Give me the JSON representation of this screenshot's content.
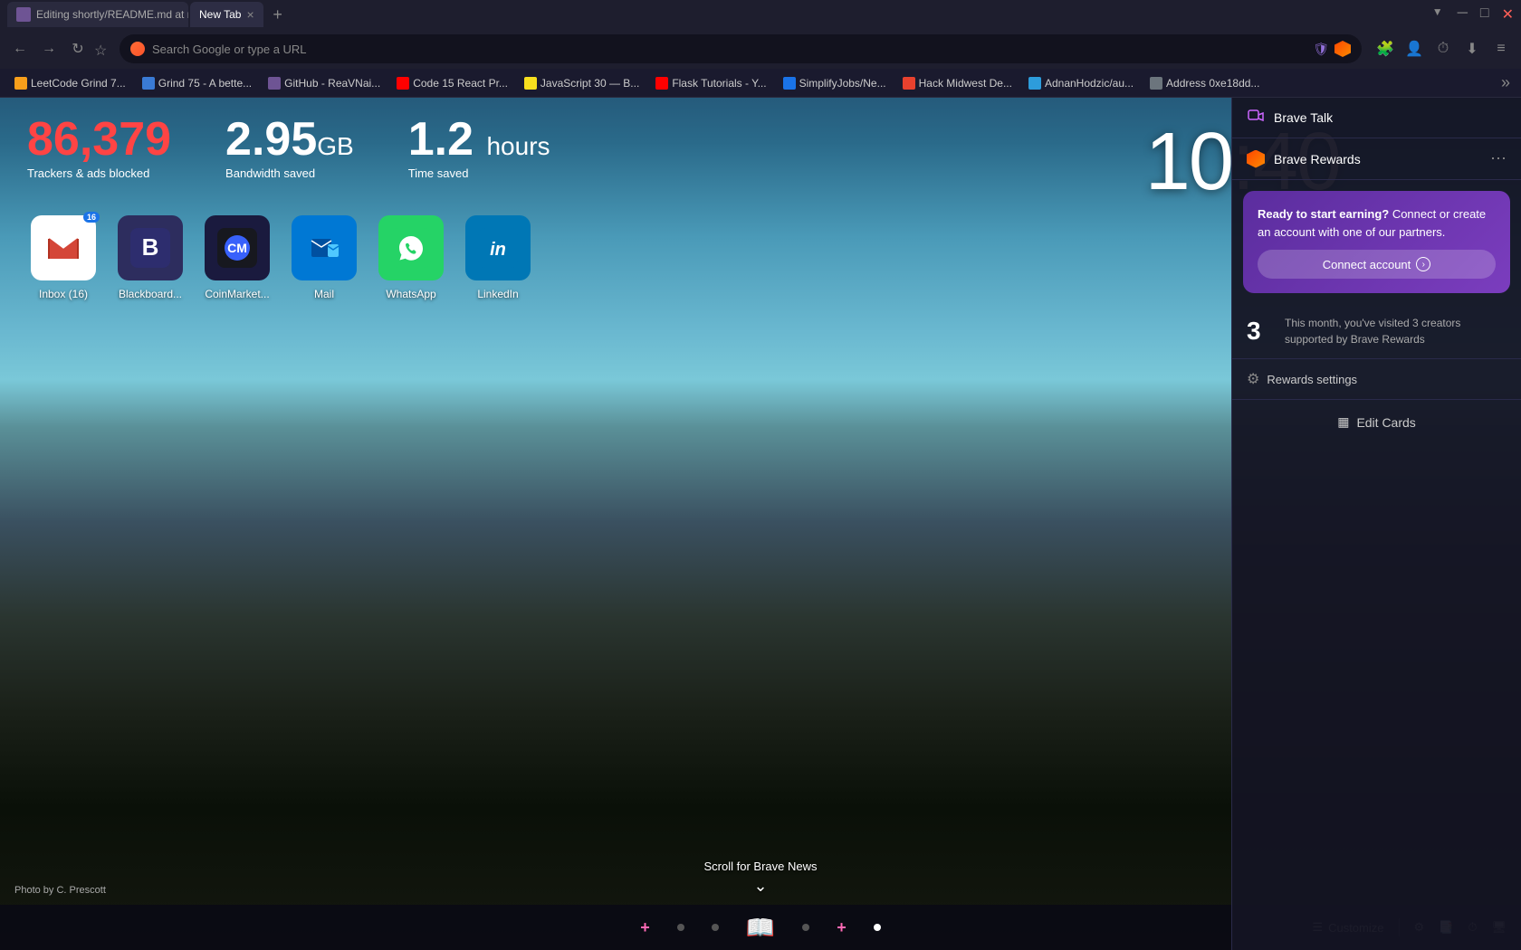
{
  "browser": {
    "tabs": [
      {
        "id": "tab-editing",
        "label": "Editing shortly/README.md at ma...",
        "favicon_class": "fav-gh",
        "active": false
      },
      {
        "id": "tab-newtab",
        "label": "New Tab",
        "favicon_class": "",
        "active": true
      }
    ],
    "address_bar": {
      "placeholder": "Search Google or type a URL",
      "value": "Search Google or type a URL"
    }
  },
  "bookmarks": [
    {
      "id": "bm-lc",
      "label": "LeetCode Grind 7...",
      "favicon_class": "fav-lc"
    },
    {
      "id": "bm-gr",
      "label": "Grind 75 - A bette...",
      "favicon_class": "fav-gr"
    },
    {
      "id": "bm-gh",
      "label": "GitHub - ReaVNai...",
      "favicon_class": "fav-gh"
    },
    {
      "id": "bm-yt1",
      "label": "Code 15 React Pr...",
      "favicon_class": "fav-yt"
    },
    {
      "id": "bm-js",
      "label": "JavaScript 30 — B...",
      "favicon_class": "fav-js"
    },
    {
      "id": "bm-yt2",
      "label": "Flask Tutorials - Y...",
      "favicon_class": "fav-yt"
    },
    {
      "id": "bm-sj",
      "label": "SimplifyJobs/Ne...",
      "favicon_class": "fav-sj"
    },
    {
      "id": "bm-hm",
      "label": "Hack Midwest De...",
      "favicon_class": "fav-hm"
    },
    {
      "id": "bm-ad",
      "label": "AdnanHodzic/au...",
      "favicon_class": "fav-ad"
    },
    {
      "id": "bm-et",
      "label": "Address 0xe18dd...",
      "favicon_class": "fav-et"
    }
  ],
  "stats": {
    "trackers_count": "86,379",
    "trackers_label": "Trackers & ads blocked",
    "bandwidth_number": "2.95",
    "bandwidth_unit": "GB",
    "bandwidth_label": "Bandwidth saved",
    "time_number": "1.2",
    "time_unit": "hours",
    "time_label": "Time saved"
  },
  "clock": {
    "time": "10:40"
  },
  "shortcuts": [
    {
      "id": "sc-gmail",
      "label": "Inbox (16)",
      "icon_class": "icon-gmail",
      "icon_text": "✉",
      "badge": "16"
    },
    {
      "id": "sc-blackboard",
      "label": "Blackboard...",
      "icon_class": "icon-blackboard",
      "icon_text": "B",
      "badge": null
    },
    {
      "id": "sc-coinmarket",
      "label": "CoinMarket...",
      "icon_class": "icon-coinmarket",
      "icon_text": "CM",
      "badge": null
    },
    {
      "id": "sc-mail",
      "label": "Mail",
      "icon_class": "icon-mail",
      "icon_text": "✉",
      "badge": null
    },
    {
      "id": "sc-whatsapp",
      "label": "WhatsApp",
      "icon_class": "icon-whatsapp",
      "icon_text": "💬",
      "badge": null
    },
    {
      "id": "sc-linkedin",
      "label": "LinkedIn",
      "icon_class": "icon-linkedin",
      "icon_text": "in",
      "badge": null
    }
  ],
  "right_panel": {
    "brave_talk_label": "Brave Talk",
    "brave_rewards_label": "Brave Rewards",
    "rewards_card": {
      "title_bold": "Ready to start earning?",
      "title_rest": " Connect or create an account with one of our partners.",
      "connect_btn_label": "Connect account"
    },
    "creators_count": "3",
    "creators_description": "This month, you've visited 3 creators supported by Brave Rewards",
    "rewards_settings_label": "Rewards settings",
    "edit_cards_label": "Edit Cards"
  },
  "bottom_bar": {
    "scroll_news_label": "Scroll for Brave News",
    "photo_credit": "Photo by C. Prescott",
    "customize_label": "Customize"
  }
}
